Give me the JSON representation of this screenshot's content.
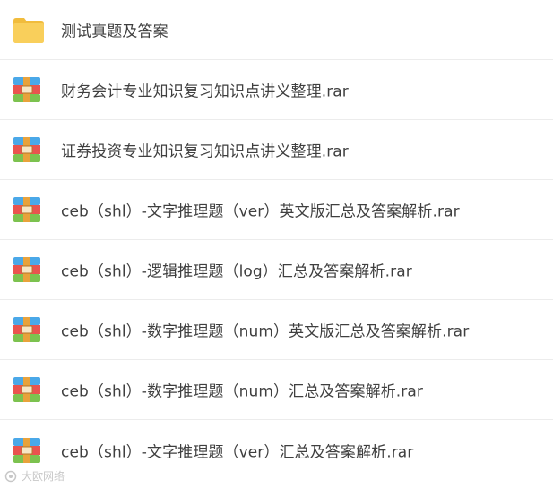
{
  "files": [
    {
      "name": "测试真题及答案",
      "type": "folder",
      "icon": "folder-icon"
    },
    {
      "name": "财务会计专业知识复习知识点讲义整理.rar",
      "type": "archive",
      "icon": "rar-archive-icon"
    },
    {
      "name": "证券投资专业知识复习知识点讲义整理.rar",
      "type": "archive",
      "icon": "rar-archive-icon"
    },
    {
      "name": "ceb（shl）-文字推理题（ver）英文版汇总及答案解析.rar",
      "type": "archive",
      "icon": "rar-archive-icon"
    },
    {
      "name": "ceb（shl）-逻辑推理题（log）汇总及答案解析.rar",
      "type": "archive",
      "icon": "rar-archive-icon"
    },
    {
      "name": "ceb（shl）-数字推理题（num）英文版汇总及答案解析.rar",
      "type": "archive",
      "icon": "rar-archive-icon"
    },
    {
      "name": "ceb（shl）-数字推理题（num）汇总及答案解析.rar",
      "type": "archive",
      "icon": "rar-archive-icon"
    },
    {
      "name": "ceb（shl）-文字推理题（ver）汇总及答案解析.rar",
      "type": "archive",
      "icon": "rar-archive-icon"
    }
  ],
  "colors": {
    "folder": "#f9cf5b",
    "folder_tab": "#f1bc3c",
    "archive_blue": "#4aa8e8",
    "archive_red": "#e9534f",
    "archive_green": "#7cc24f",
    "archive_strap": "#e8a23b",
    "text": "#3f3f3f"
  },
  "watermark": {
    "icon": "camera-logo-icon",
    "text": "大欧网络"
  }
}
